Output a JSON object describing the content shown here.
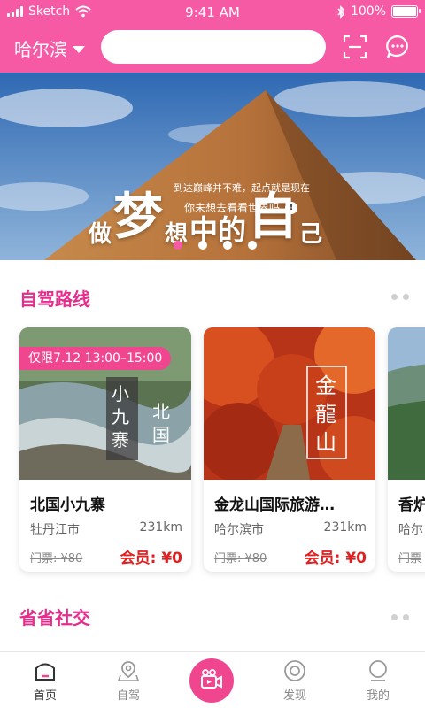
{
  "status": {
    "carrier": "Sketch",
    "time": "9:41 AM",
    "battery": "100%"
  },
  "header": {
    "city": "哈尔滨",
    "search_placeholder": "",
    "icons": {
      "caret": "chevron-down-icon",
      "scan": "scan-icon",
      "message": "chat-icon"
    }
  },
  "banner": {
    "title_parts": [
      "做",
      "梦",
      "想",
      "中的",
      "自",
      "己"
    ],
    "sub1": "到达巅峰并不难，起点就是现在",
    "sub2": "你未想去看看世界吗",
    "page_count": 4,
    "active_page": 1
  },
  "sections": {
    "drive": "自驾路线",
    "social": "省省社交"
  },
  "cards": [
    {
      "promo": "仅限7.12 13:00–15:00",
      "name": "北国小九寨",
      "place": "牡丹江市",
      "dist": "231km",
      "ticket": "门票: ¥80",
      "member": "会员: ¥0",
      "image_text": [
        "小九寨",
        "北国"
      ]
    },
    {
      "promo": "",
      "name": "金龙山国际旅游…",
      "place": "哈尔滨市",
      "dist": "231km",
      "ticket": "门票: ¥80",
      "member": "会员: ¥0",
      "image_text": [
        "金龍山"
      ]
    },
    {
      "promo": "",
      "name": "香炉",
      "place": "哈尔",
      "dist": "",
      "ticket": "门票",
      "member": "",
      "image_text": []
    }
  ],
  "tabs": [
    {
      "label": "首页",
      "icon": "home-icon",
      "active": true
    },
    {
      "label": "自驾",
      "icon": "map-pin-icon",
      "active": false
    },
    {
      "label": "",
      "icon": "video-camera-icon",
      "active": false
    },
    {
      "label": "发现",
      "icon": "discover-icon",
      "active": false
    },
    {
      "label": "我的",
      "icon": "profile-icon",
      "active": false
    }
  ],
  "colors": {
    "brand": "#f75aa5",
    "accent": "#e52e8c",
    "price": "#e02020"
  }
}
